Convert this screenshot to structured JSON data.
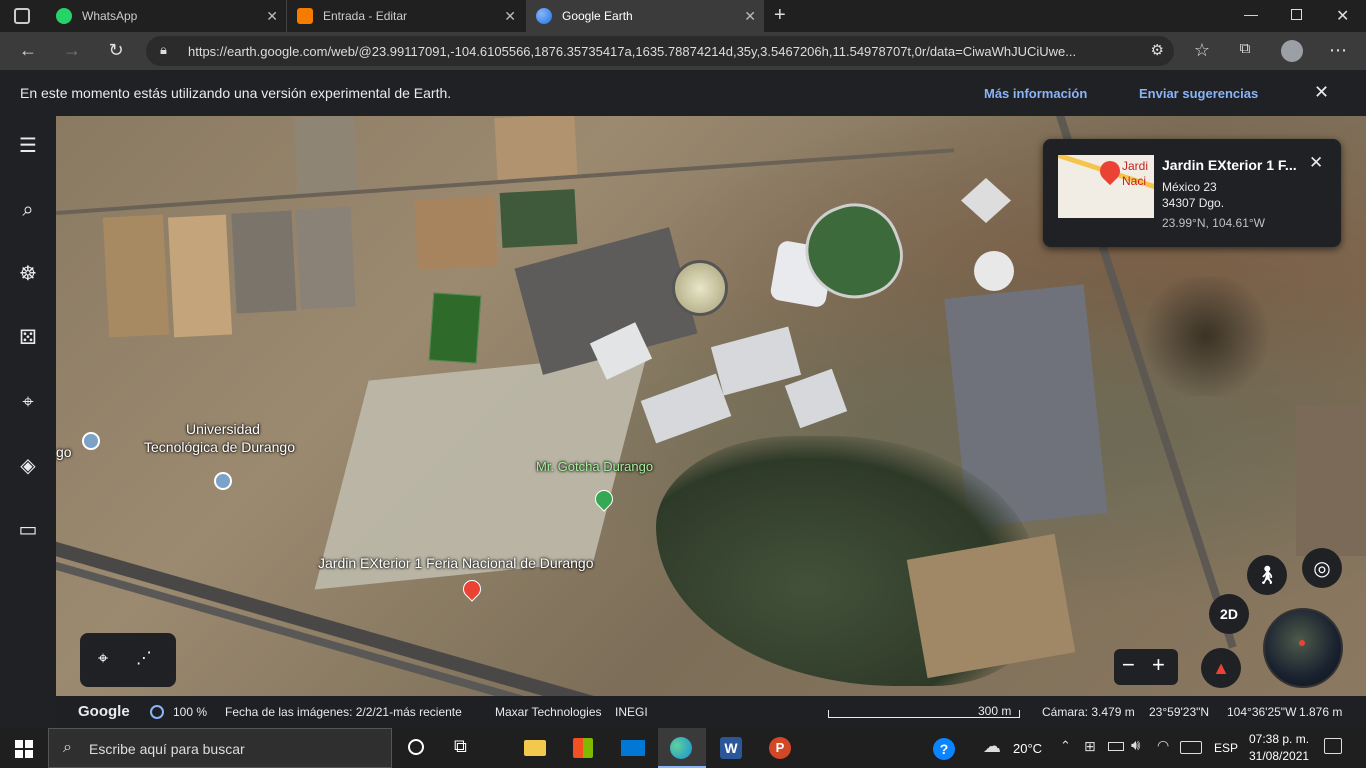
{
  "tabs": [
    {
      "label": "WhatsApp",
      "color": "#25d366"
    },
    {
      "label": "Entrada - Editar",
      "color": "#f57c00"
    },
    {
      "label": "Google Earth",
      "color": "#4285f4"
    }
  ],
  "url": "https://earth.google.com/web/@23.99117091,-104.6105566,1876.35735417a,1635.78874214d,35y,3.5467206h,11.54978707t,0r/data=CiwaWhJUCiUwe...",
  "notice": {
    "text": "En este momento estás utilizando una versión experimental de Earth.",
    "more_info": "Más información",
    "feedback": "Enviar sugerencias"
  },
  "map_labels": {
    "university_line1": "Universidad",
    "university_line2": "Tecnológica de Durango",
    "gotcha": "Mr. Gotcha Durango",
    "jardin": "Jardin EXterior 1 Feria Nacional de Durango",
    "left_cut": "go"
  },
  "infocard": {
    "title": "Jardin EXterior 1 F...",
    "address1": "México 23",
    "address2": "34307 Dgo.",
    "coords": "23.99°N, 104.61°W",
    "thumb_text": "Jardi Naci"
  },
  "controls": {
    "mode_2d": "2D",
    "minus": "−",
    "plus": "+"
  },
  "earthbar": {
    "logo": "Google",
    "zoom": "100 %",
    "imagery_date": "Fecha de las imágenes: 2/2/21-más reciente",
    "credits": "Maxar Technologies",
    "inegi": "INEGI",
    "scale": "300 m",
    "camera": "Cámara: 3.479 m",
    "lat": "23°59'23\"N",
    "lon": "104°36'25\"W",
    "elevation": "1.876 m"
  },
  "taskbar": {
    "search_placeholder": "Escribe aquí para buscar",
    "temp": "20°C",
    "lang": "ESP",
    "time": "07:38 p. m.",
    "date": "31/08/2021"
  }
}
